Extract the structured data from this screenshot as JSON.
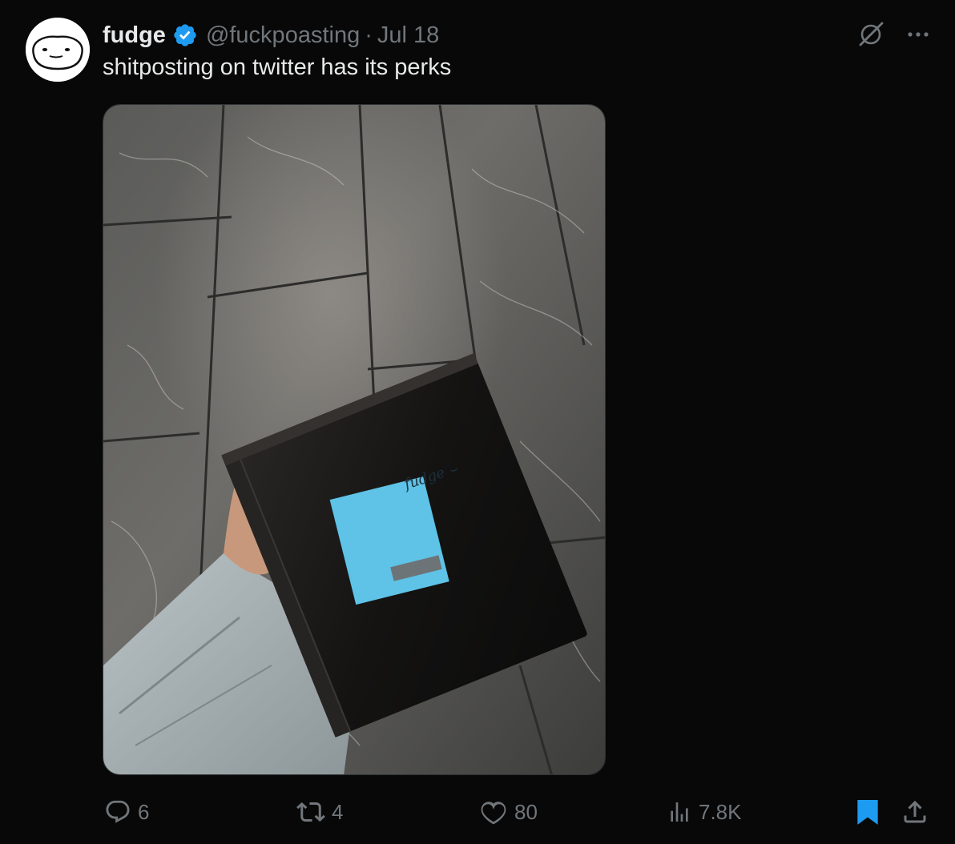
{
  "tweet": {
    "display_name": "fudge",
    "handle": "@fuckpoasting",
    "separator": "·",
    "date": "Jul 18",
    "text": "shitposting on twitter has its perks"
  },
  "media": {
    "note_text": "fudge ⌣"
  },
  "actions": {
    "replies": "6",
    "reposts": "4",
    "likes": "80",
    "views": "7.8K"
  },
  "icons": {
    "verified": "verified-badge-icon",
    "grok": "grok-icon",
    "more": "more-icon",
    "reply": "reply-icon",
    "repost": "repost-icon",
    "like": "heart-icon",
    "views": "views-icon",
    "bookmark": "bookmark-icon",
    "share": "share-icon"
  },
  "colors": {
    "background": "#080808",
    "text": "#e7e9ea",
    "secondary": "#71767b",
    "accent": "#1d9bf0"
  }
}
